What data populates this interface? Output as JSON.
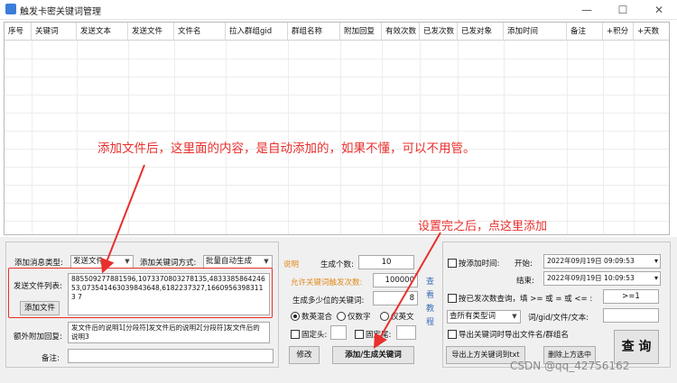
{
  "window": {
    "title": "触发卡密关键词管理",
    "min": "—",
    "max": "☐",
    "close": "✕"
  },
  "table": {
    "columns": [
      "序号",
      "关键词",
      "发送文本",
      "发送文件",
      "文件名",
      "拉入群组gid",
      "群组名称",
      "附加回复",
      "有效次数",
      "已发次数",
      "已发对象",
      "添加时间",
      "备注",
      "+积分",
      "+天数"
    ]
  },
  "annotations": {
    "note1": "添加文件后，这里面的内容，是自动添加的，如果不懂，可以不用管。",
    "note2": "设置完之后，点这里添加"
  },
  "form": {
    "msg_type_label": "添加消息类型:",
    "msg_type_value": "发送文件",
    "kw_mode_label": "添加关键词方式:",
    "kw_mode_value": "批量自动生成",
    "explain_label": "说明",
    "file_list_label": "发送文件列表:",
    "file_list_value": "885509277881596,107337080327813​5,483338586424653,073541463039843648,6182237327,16609563983113 7",
    "add_file_button": "添加文件",
    "extra_reply_label": "额外附加回复:",
    "extra_reply_value": "发文件后的说明1[分段符]发文件后的说明2[分段符]发文件后的说明3",
    "remark_label": "备注:",
    "remark_value": "",
    "gen_count_label": "生成个数:",
    "gen_count_value": "10",
    "allow_times_label": "允许关键词触发次数:",
    "allow_times_value": "100000",
    "kw_digits_label": "生成多少位的关键词:",
    "kw_digits_value": "8",
    "radio_mixed": "数英混合",
    "radio_digits": "仅数字",
    "radio_english": "仅英文",
    "fixed_head_label": "固定头:",
    "fixed_tail_label": "固定尾:",
    "modify_button": "修改",
    "add_generate_button": "添加/生成关键词",
    "tutorial_text": "查看教程"
  },
  "query": {
    "by_time_label": "按添加时间:",
    "start_label": "开始:",
    "start_value": "2022年09月19日  09:09:53",
    "end_label": "结束:",
    "end_value": "2022年09月19日  10:09:53",
    "by_sent_label": "按已发次数查询，填 >= 或 = 或 <= :",
    "sent_value": ">=1",
    "type_select": "查所有类型词",
    "filter_label": "词/gid/文件/文本:",
    "filter_value": "",
    "export_check_label": "导出关键词时导出文件名/群组名",
    "export_button": "导出上方关键词到txt",
    "delete_button": "删除上方选中",
    "query_button": "查 询"
  },
  "watermark": "CSDN @qq_42756162"
}
